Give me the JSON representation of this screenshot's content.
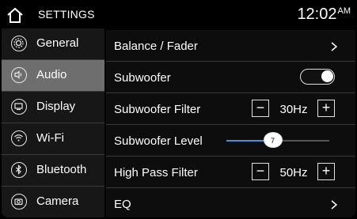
{
  "header": {
    "title": "SETTINGS",
    "home_icon": "home-icon",
    "clock_time": "12:02",
    "clock_ampm": "AM"
  },
  "sidebar": {
    "items": [
      {
        "label": "General",
        "icon": "gear-icon",
        "active": false
      },
      {
        "label": "Audio",
        "icon": "speaker-icon",
        "active": true
      },
      {
        "label": "Display",
        "icon": "display-icon",
        "active": false
      },
      {
        "label": "Wi-Fi",
        "icon": "wifi-icon",
        "active": false
      },
      {
        "label": "Bluetooth",
        "icon": "bluetooth-icon",
        "active": false
      },
      {
        "label": "Camera",
        "icon": "camera-icon",
        "active": false
      }
    ]
  },
  "audio_settings": {
    "balance_fader": {
      "label": "Balance / Fader"
    },
    "subwoofer": {
      "label": "Subwoofer",
      "enabled": true
    },
    "subwoofer_filter": {
      "label": "Subwoofer Filter",
      "value": "30Hz",
      "minus": "−",
      "plus": "+"
    },
    "subwoofer_level": {
      "label": "Subwoofer Level",
      "value": "7",
      "level_fraction": 0.45
    },
    "high_pass_filter": {
      "label": "High Pass Filter",
      "value": "50Hz",
      "minus": "−",
      "plus": "+"
    },
    "eq": {
      "label": "EQ"
    }
  },
  "colors": {
    "accent": "#4a8fd8",
    "active_tab": "#6e6e6e"
  }
}
